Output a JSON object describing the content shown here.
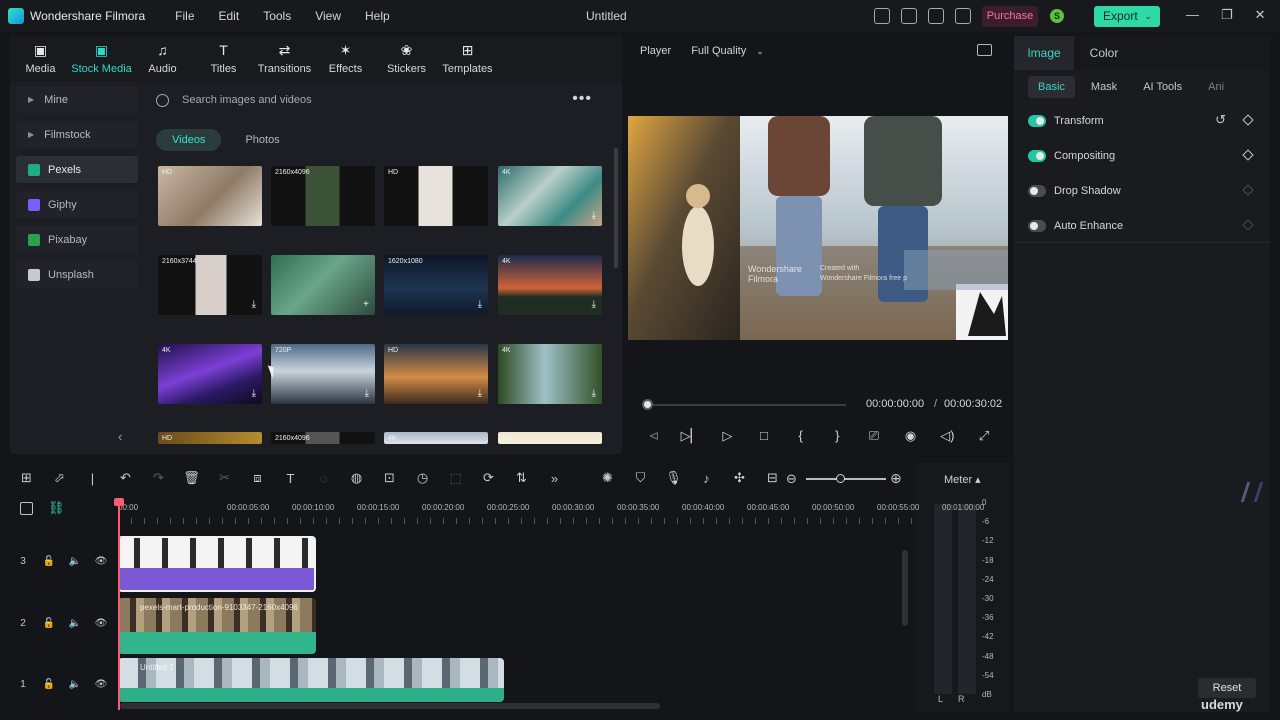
{
  "app": {
    "name": "Wondershare Filmora",
    "document_title": "Untitled"
  },
  "menu": [
    "File",
    "Edit",
    "Tools",
    "View",
    "Help"
  ],
  "titlebar": {
    "purchase_label": "Purchase",
    "avatar_initial": "S",
    "export_label": "Export",
    "export_chevron": "⌄",
    "min": "—",
    "restore": "❐",
    "close": "✕"
  },
  "media_tabs": [
    {
      "label": "Media",
      "icon": "media-icon",
      "glyph": "▣"
    },
    {
      "label": "Stock Media",
      "icon": "stock-media-icon",
      "glyph": "▣"
    },
    {
      "label": "Audio",
      "icon": "audio-icon",
      "glyph": "♫"
    },
    {
      "label": "Titles",
      "icon": "titles-icon",
      "glyph": "T"
    },
    {
      "label": "Transitions",
      "icon": "transitions-icon",
      "glyph": "⇄"
    },
    {
      "label": "Effects",
      "icon": "effects-icon",
      "glyph": "✶"
    },
    {
      "label": "Stickers",
      "icon": "stickers-icon",
      "glyph": "❀"
    },
    {
      "label": "Templates",
      "icon": "templates-icon",
      "glyph": "⊞"
    }
  ],
  "active_media_tab": "Stock Media",
  "stock_sources": [
    {
      "label": "Mine",
      "caret": "▶"
    },
    {
      "label": "Filmstock",
      "caret": "▶"
    },
    {
      "label": "Pexels",
      "icon_color": "#1fae83"
    },
    {
      "label": "Giphy",
      "icon_color": "#7b5cff"
    },
    {
      "label": "Pixabay",
      "icon_color": "#2ba14b"
    },
    {
      "label": "Unsplash",
      "icon_color": "#c9cacd"
    }
  ],
  "active_source": "Pexels",
  "collapse_glyph": "‹",
  "search": {
    "placeholder": "Search images and videos",
    "more": "•••"
  },
  "media_subtabs": [
    "Videos",
    "Photos"
  ],
  "active_subtab": "Videos",
  "thumbnails": [
    {
      "badge": "HD",
      "bg": "linear-gradient(135deg,#c9b8a2,#8d7a66 55%,#e9e2d8)",
      "download": ""
    },
    {
      "badge": "2160x4096",
      "bg": "linear-gradient(90deg,#111 0 33%,#3b5237 33% 66%,#111 66%)",
      "download": ""
    },
    {
      "badge": "HD",
      "bg": "linear-gradient(90deg,#111 0 33%,#e8e2dc 33% 66%,#111 66%)",
      "download": ""
    },
    {
      "badge": "4K",
      "bg": "linear-gradient(135deg,#2a6b6e,#b9cfc7 40%,#3d8a86 70%,#c6a783)",
      "download": "⤓"
    },
    {
      "badge": "2160x3744",
      "bg": "linear-gradient(90deg,#111 0 36%,#d8cfcb 36% 66%,#111 66%)",
      "download": "⤓"
    },
    {
      "badge": "",
      "bg": "linear-gradient(135deg,#2f6f51,#6aa58a 45%,#2d4c3c)",
      "download": "+"
    },
    {
      "badge": "1620x1080",
      "bg": "linear-gradient(180deg,#0d1626,#1e3550 55%,#0d1a2a)",
      "download": "⤓"
    },
    {
      "badge": "4K",
      "bg": "linear-gradient(180deg,#1b2a49,#d0633a 55%,#1e2c22 70%)",
      "download": "⤓"
    },
    {
      "badge": "4K",
      "bg": "linear-gradient(160deg,#1e1247,#7c3fd6 45%,#2b1a66 70%,#0d0a1e)",
      "download": "⤓"
    },
    {
      "badge": "720P",
      "bg": "linear-gradient(180deg,#4c6a86,#c9d4dc 45%,#2b3642)",
      "download": "⤓"
    },
    {
      "badge": "HD",
      "bg": "linear-gradient(180deg,#293747,#d28c47 55%,#3b2a1f)",
      "download": "⤓"
    },
    {
      "badge": "4K",
      "bg": "linear-gradient(90deg,#2d4a22,#9ec1c6 45%,#33512a)",
      "download": "⤓"
    },
    {
      "badge": "HD",
      "bg": "linear-gradient(90deg,#6a4b1b,#b88c2e)",
      "download": ""
    },
    {
      "badge": "2160x4096",
      "bg": "linear-gradient(90deg,#111 0 33%,#555 33% 66%,#111 66%)",
      "download": ""
    },
    {
      "badge": "4K",
      "bg": "linear-gradient(180deg,#a9b7c4,#dfe6ec)",
      "download": ""
    },
    {
      "badge": "HD",
      "bg": "linear-gradient(180deg,#efe6cf,#f7f0dc)",
      "download": ""
    }
  ],
  "player": {
    "label": "Player",
    "quality": "Full Quality",
    "quality_chevron": "⌄",
    "watermark_brand": "Wondershare\nFilmora",
    "watermark_text": "Created with\nWondershare Filmora free p",
    "time_current": "00:00:00:00",
    "time_sep": "/",
    "time_total": "00:00:30:02",
    "controls": [
      "⊲",
      "▷▏",
      "▷",
      "□",
      "{",
      "}",
      "⎚",
      "◉",
      "◁)",
      "⤢"
    ]
  },
  "properties": {
    "tabs": [
      "Image",
      "Color"
    ],
    "active_tab": "Image",
    "subtabs": [
      "Basic",
      "Mask",
      "AI Tools",
      "Ani"
    ],
    "active_subtab": "Basic",
    "rows": [
      {
        "label": "Transform",
        "on": true,
        "reset": "↺"
      },
      {
        "label": "Compositing",
        "on": true
      },
      {
        "label": "Drop Shadow",
        "on": false
      },
      {
        "label": "Auto Enhance",
        "on": false
      }
    ],
    "reset_label": "Reset"
  },
  "toolbar": [
    "⊞",
    "⬀",
    "|",
    "↶",
    "↷",
    "🗑",
    "✂",
    "⧈",
    "T",
    "◌",
    "◍",
    "⊡",
    "◷",
    "⬚",
    "⟳",
    "⇅",
    "»"
  ],
  "toolbar_right": [
    "✺",
    "⛉",
    "🎙",
    "♪",
    "✣",
    "⊟"
  ],
  "zoom": {
    "minus": "⊖",
    "plus": "⊕"
  },
  "meter": {
    "label": "Meter ▴",
    "scale": [
      "0",
      "-6",
      "-12",
      "-18",
      "-24",
      "-30",
      "-36",
      "-42",
      "-48",
      "-54",
      "dB"
    ],
    "channels": [
      "L",
      "R"
    ]
  },
  "timeline": {
    "ruler": [
      "00:00",
      "00:00:05:00",
      "00:00:10:00",
      "00:00:15:00",
      "00:00:20:00",
      "00:00:25:00",
      "00:00:30:00",
      "00:00:35:00",
      "00:00:40:00",
      "00:00:45:00",
      "00:00:50:00",
      "00:00:55:00",
      "00:01:00:00"
    ],
    "tracks": [
      {
        "index": "3",
        "clip_name": ""
      },
      {
        "index": "2",
        "clip_name": "pexels-mart-production-9103347-2160x4096"
      },
      {
        "index": "1",
        "clip_name": "Untitled 1"
      }
    ]
  },
  "watermark": "udemy"
}
